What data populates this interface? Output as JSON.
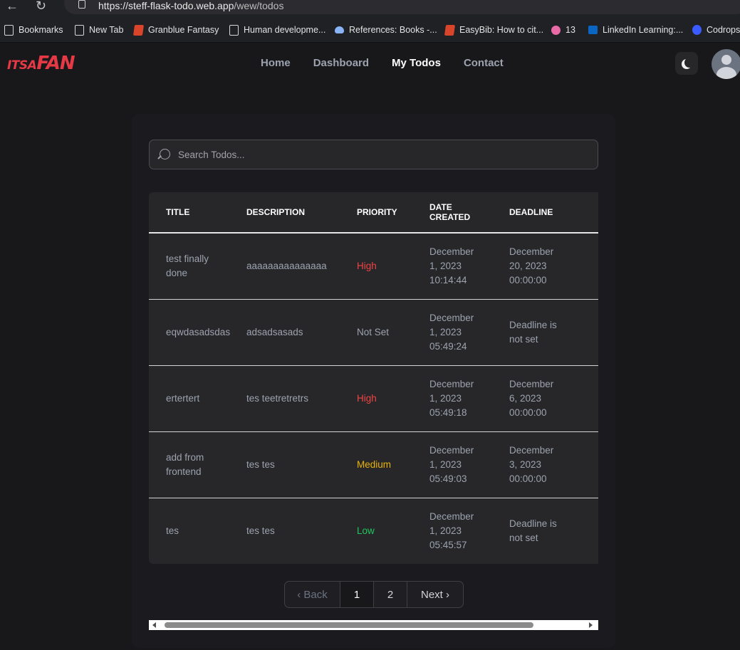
{
  "browser": {
    "url_host": "https://steff-flask-todo.web.app",
    "url_path": "/wew/todos",
    "bookmarks": [
      {
        "label": "Bookmarks",
        "icon": "page-icon"
      },
      {
        "label": "New Tab",
        "icon": "page-icon"
      },
      {
        "label": "Granblue Fantasy",
        "icon": "game-icon"
      },
      {
        "label": "Human developme...",
        "icon": "page-icon"
      },
      {
        "label": "References: Books -...",
        "icon": "cloud-icon"
      },
      {
        "label": "EasyBib: How to cit...",
        "icon": "easybib-icon"
      },
      {
        "label": "13",
        "icon": "badge-icon"
      },
      {
        "label": "LinkedIn Learning:...",
        "icon": "play-icon"
      },
      {
        "label": "Codrops",
        "icon": "drop-icon"
      }
    ]
  },
  "header": {
    "logo_small": "ITSA",
    "logo_big": "FAN",
    "nav": [
      "Home",
      "Dashboard",
      "My Todos",
      "Contact"
    ],
    "active_nav": "My Todos"
  },
  "search": {
    "placeholder": "Search Todos..."
  },
  "table": {
    "columns": [
      "TITLE",
      "DESCRIPTION",
      "PRIORITY",
      "DATE CREATED",
      "DEADLINE"
    ],
    "rows": [
      {
        "title": "test finally done",
        "description": "aaaaaaaaaaaaaaa",
        "priority": "High",
        "date_created": "December 1, 2023 10:14:44",
        "deadline": "December 20, 2023 00:00:00"
      },
      {
        "title": "eqwdasadsdas",
        "description": "adsadsasads",
        "priority": "Not Set",
        "date_created": "December 1, 2023 05:49:24",
        "deadline": "Deadline is not set"
      },
      {
        "title": "ertertert",
        "description": "tes teetretretrs",
        "priority": "High",
        "date_created": "December 1, 2023 05:49:18",
        "deadline": "December 6, 2023 00:00:00"
      },
      {
        "title": "add from frontend",
        "description": "tes tes",
        "priority": "Medium",
        "date_created": "December 1, 2023 05:49:03",
        "deadline": "December 3, 2023 00:00:00"
      },
      {
        "title": "tes",
        "description": "tes tes",
        "priority": "Low",
        "date_created": "December 1, 2023 05:45:57",
        "deadline": "Deadline is not set"
      }
    ]
  },
  "pagination": {
    "back": "Back",
    "pages": [
      "1",
      "2"
    ],
    "current_page": "1",
    "next": "Next"
  },
  "colors": {
    "high": "#ef4444",
    "medium": "#eab308",
    "low": "#22c55e",
    "not_set": "#9ca3af",
    "brand": "#e63946"
  }
}
